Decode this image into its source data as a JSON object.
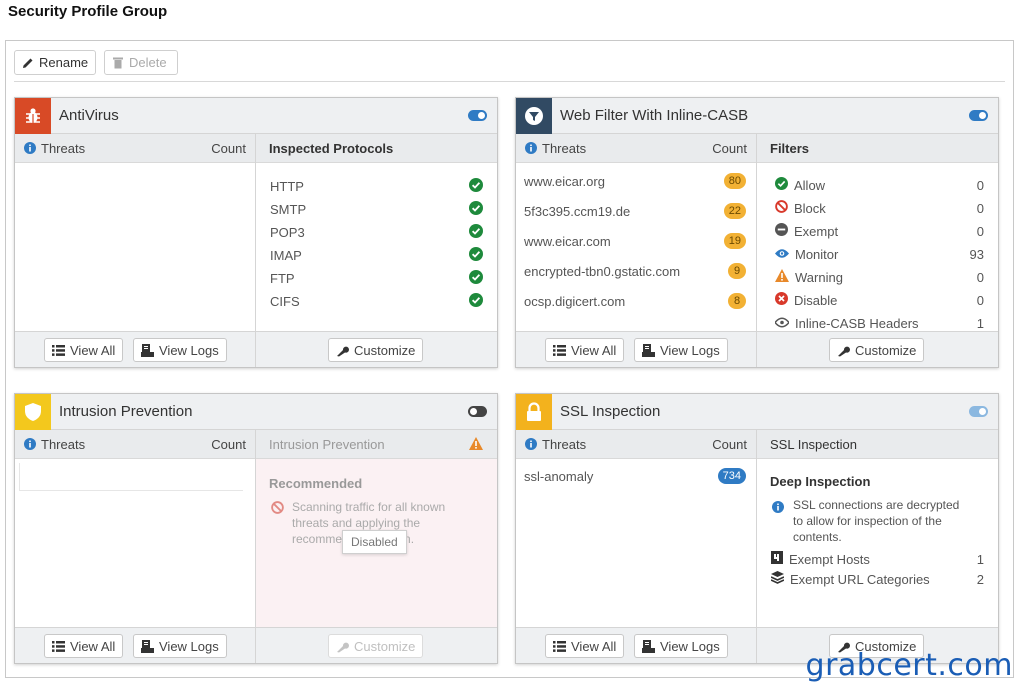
{
  "page": {
    "title": "Security Profile Group"
  },
  "toolbar": {
    "rename": "Rename",
    "delete": "Delete"
  },
  "colors": {
    "antivirus": "#d84a26",
    "webfilter": "#314a63",
    "ips": "#f3c81d",
    "ssl": "#f3b21d",
    "toggle_on": "#2f7bc4",
    "toggle_off": "#444444",
    "check": "#1e8a3c"
  },
  "common": {
    "threats": "Threats",
    "count": "Count",
    "view_all": "View All",
    "view_logs": "View Logs",
    "customize": "Customize"
  },
  "antivirus": {
    "title": "AntiVirus",
    "enabled": true,
    "right_title": "Inspected Protocols",
    "protocols": [
      "HTTP",
      "SMTP",
      "POP3",
      "IMAP",
      "FTP",
      "CIFS"
    ]
  },
  "webfilter": {
    "title": "Web Filter With Inline-CASB",
    "enabled": true,
    "right_title": "Filters",
    "threats": [
      {
        "name": "www.eicar.org",
        "count": "80"
      },
      {
        "name": "5f3c395.ccm19.de",
        "count": "22"
      },
      {
        "name": "www.eicar.com",
        "count": "19"
      },
      {
        "name": "encrypted-tbn0.gstatic.com",
        "count": "9"
      },
      {
        "name": "ocsp.digicert.com",
        "count": "8"
      }
    ],
    "filters": [
      {
        "label": "Allow",
        "count": "0",
        "icon": "check-circle-icon"
      },
      {
        "label": "Block",
        "count": "0",
        "icon": "block-icon"
      },
      {
        "label": "Exempt",
        "count": "0",
        "icon": "minus-circle-icon"
      },
      {
        "label": "Monitor",
        "count": "93",
        "icon": "eye-icon"
      },
      {
        "label": "Warning",
        "count": "0",
        "icon": "warning-icon"
      },
      {
        "label": "Disable",
        "count": "0",
        "icon": "x-circle-icon"
      },
      {
        "label": "Inline-CASB Headers",
        "count": "1",
        "icon": "cloud-eye-icon"
      }
    ]
  },
  "ips": {
    "title": "Intrusion Prevention",
    "enabled": false,
    "right_title": "Intrusion Prevention",
    "recommended": "Recommended",
    "desc_line1": "Scanning traffic for all known",
    "desc_line2": "threats and applying the",
    "desc_line3_a": "recomme",
    "desc_line3_b": "n.",
    "tooltip": "Disabled"
  },
  "ssl": {
    "title": "SSL Inspection",
    "enabled": true,
    "right_title": "SSL Inspection",
    "threats": [
      {
        "name": "ssl-anomaly",
        "count": "734"
      }
    ],
    "mode": "Deep Inspection",
    "info_line1": "SSL connections are decrypted",
    "info_line2": "to allow for inspection of the",
    "info_line3": "contents.",
    "exempt_hosts_label": "Exempt Hosts",
    "exempt_hosts": "1",
    "exempt_url_label": "Exempt URL Categories",
    "exempt_url": "2"
  },
  "watermark": "grabcert.com"
}
